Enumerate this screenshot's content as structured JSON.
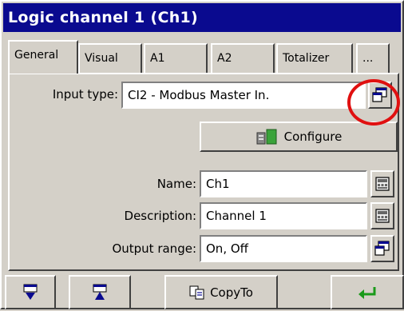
{
  "window": {
    "title": "Logic channel 1 (Ch1)"
  },
  "tabs": [
    {
      "label": "General",
      "active": true
    },
    {
      "label": "Visual",
      "active": false
    },
    {
      "label": "A1",
      "active": false
    },
    {
      "label": "A2",
      "active": false
    },
    {
      "label": "Totalizer",
      "active": false
    },
    {
      "label": "...",
      "active": false
    }
  ],
  "form": {
    "input_type": {
      "label": "Input type:",
      "value": "CI2 - Modbus Master In."
    },
    "configure_label": "Configure",
    "name": {
      "label": "Name:",
      "value": "Ch1"
    },
    "description": {
      "label": "Description:",
      "value": "Channel 1"
    },
    "output_range": {
      "label": "Output range:",
      "value": "On, Off"
    }
  },
  "bottombar": {
    "copyto_label": "CopyTo"
  },
  "colors": {
    "title_bg": "#0a0a8f",
    "highlight_circle": "#e01010",
    "enter_arrow": "#1a9a1a"
  },
  "icons": [
    "select-list-icon",
    "configure-tool-icon",
    "keyboard-icon",
    "move-down-icon",
    "move-up-icon",
    "copy-icon",
    "enter-icon"
  ]
}
